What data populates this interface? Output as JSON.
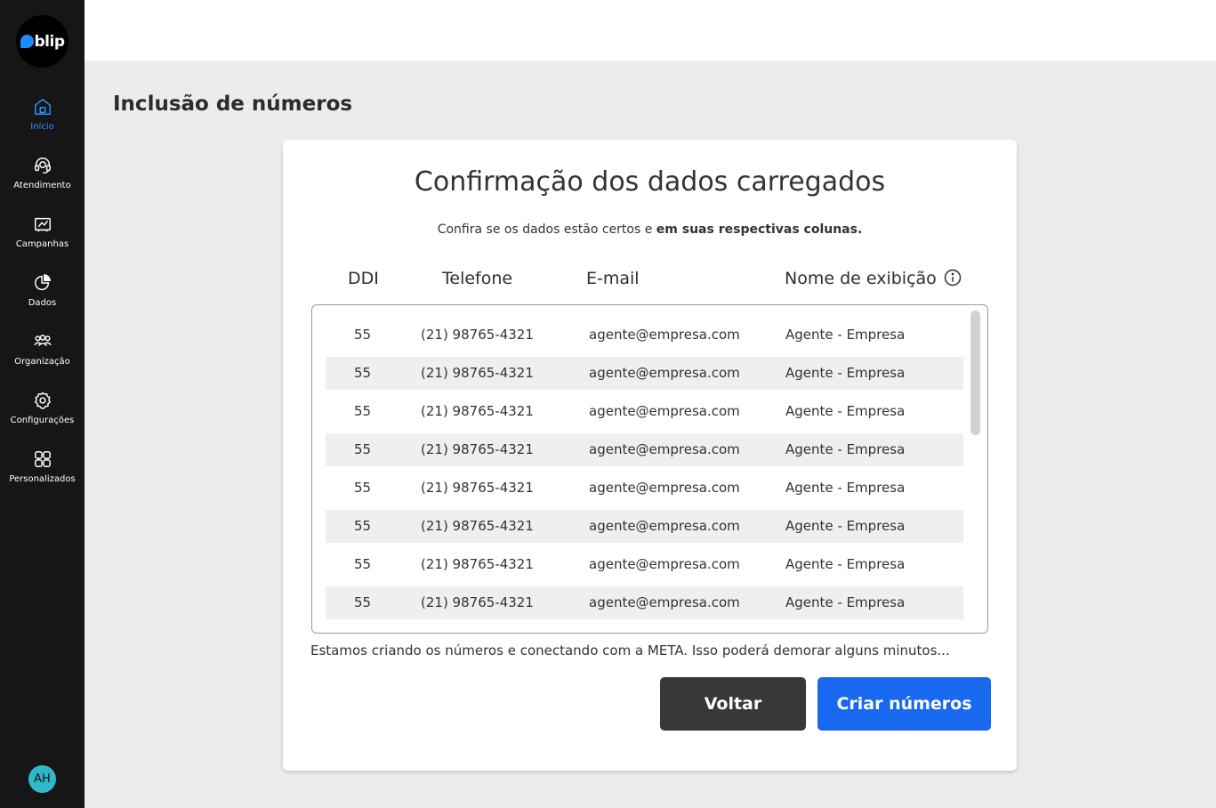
{
  "brand": {
    "logo_text": "blip",
    "accent_color": "#1e8cff",
    "sidebar_bg": "#161616"
  },
  "sidebar": {
    "items": [
      {
        "label": "Início",
        "icon": "home-icon",
        "active": true
      },
      {
        "label": "Atendimento",
        "icon": "headset-icon",
        "active": false
      },
      {
        "label": "Campanhas",
        "icon": "megaphone-icon",
        "active": false
      },
      {
        "label": "Dados",
        "icon": "pie-chart-icon",
        "active": false
      },
      {
        "label": "Organização",
        "icon": "people-icon",
        "active": false
      },
      {
        "label": "Configurações",
        "icon": "gear-icon",
        "active": false
      },
      {
        "label": "Personalizados",
        "icon": "grid-icon",
        "active": false
      }
    ],
    "avatar_initials": "AH"
  },
  "page": {
    "title": "Inclusão de números"
  },
  "card": {
    "title": "Confirmação dos dados carregados",
    "subtitle_regular": "Confira se os dados estão certos e ",
    "subtitle_bold": "em suas respectivas colunas.",
    "columns": {
      "ddi": "DDI",
      "phone": "Telefone",
      "email": "E-mail",
      "display_name": "Nome de exibição"
    },
    "rows": [
      {
        "ddi": "55",
        "phone": "(21) 98765-4321",
        "email": "agente@empresa.com",
        "name": "Agente - Empresa"
      },
      {
        "ddi": "55",
        "phone": "(21) 98765-4321",
        "email": "agente@empresa.com",
        "name": "Agente - Empresa"
      },
      {
        "ddi": "55",
        "phone": "(21) 98765-4321",
        "email": "agente@empresa.com",
        "name": "Agente - Empresa"
      },
      {
        "ddi": "55",
        "phone": "(21) 98765-4321",
        "email": "agente@empresa.com",
        "name": "Agente - Empresa"
      },
      {
        "ddi": "55",
        "phone": "(21) 98765-4321",
        "email": "agente@empresa.com",
        "name": "Agente - Empresa"
      },
      {
        "ddi": "55",
        "phone": "(21) 98765-4321",
        "email": "agente@empresa.com",
        "name": "Agente - Empresa"
      },
      {
        "ddi": "55",
        "phone": "(21) 98765-4321",
        "email": "agente@empresa.com",
        "name": "Agente - Empresa"
      },
      {
        "ddi": "55",
        "phone": "(21) 98765-4321",
        "email": "agente@empresa.com",
        "name": "Agente - Empresa"
      }
    ],
    "status_message": "Estamos criando os números e conectando com a META. Isso poderá demorar alguns minutos...",
    "back_label": "Voltar",
    "create_label": "Criar números"
  }
}
